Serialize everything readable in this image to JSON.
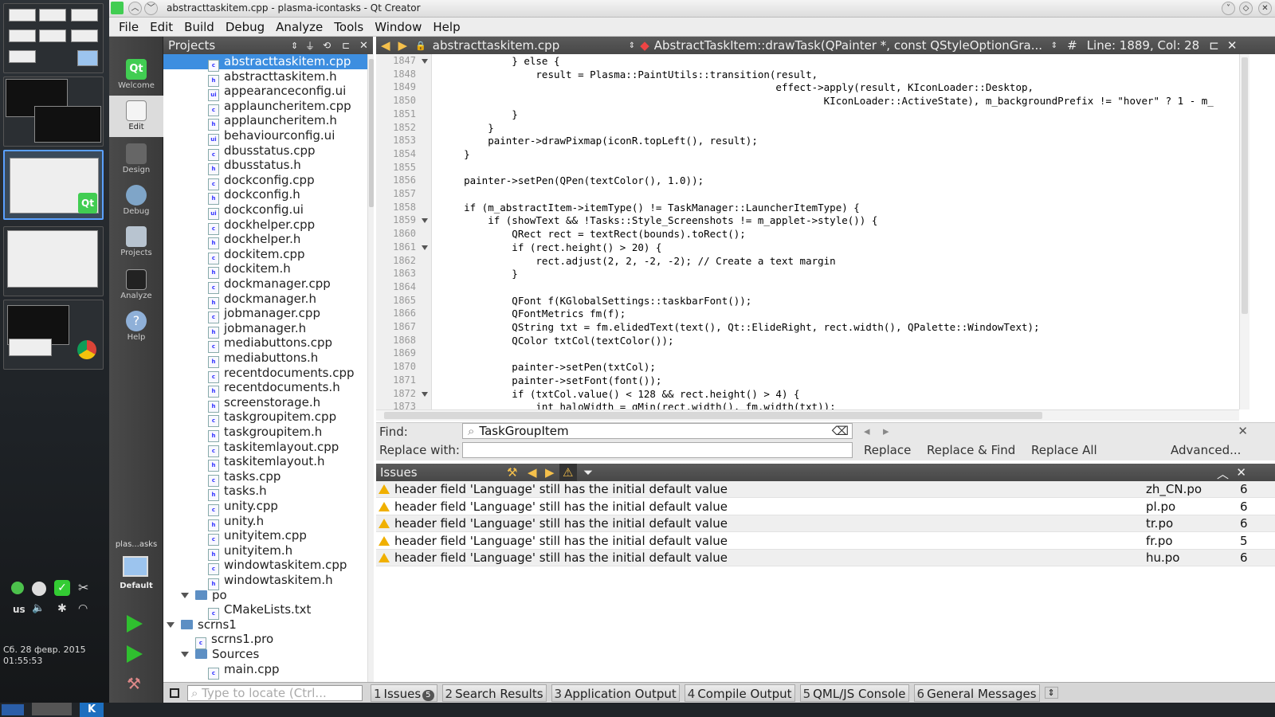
{
  "window": {
    "title": "abstracttaskitem.cpp - plasma-icontasks - Qt Creator"
  },
  "menu": [
    "File",
    "Edit",
    "Build",
    "Debug",
    "Analyze",
    "Tools",
    "Window",
    "Help"
  ],
  "modes": [
    {
      "label": "Welcome"
    },
    {
      "label": "Edit"
    },
    {
      "label": "Design"
    },
    {
      "label": "Debug"
    },
    {
      "label": "Projects"
    },
    {
      "label": "Analyze"
    },
    {
      "label": "Help"
    }
  ],
  "kit": {
    "project": "plas...asks",
    "config": "Default"
  },
  "projects": {
    "header": "Projects",
    "files": [
      "abstracttaskitem.cpp",
      "abstracttaskitem.h",
      "appearanceconfig.ui",
      "applauncheritem.cpp",
      "applauncheritem.h",
      "behaviourconfig.ui",
      "dbusstatus.cpp",
      "dbusstatus.h",
      "dockconfig.cpp",
      "dockconfig.h",
      "dockconfig.ui",
      "dockhelper.cpp",
      "dockhelper.h",
      "dockitem.cpp",
      "dockitem.h",
      "dockmanager.cpp",
      "dockmanager.h",
      "jobmanager.cpp",
      "jobmanager.h",
      "mediabuttons.cpp",
      "mediabuttons.h",
      "recentdocuments.cpp",
      "recentdocuments.h",
      "screenstorage.h",
      "taskgroupitem.cpp",
      "taskgroupitem.h",
      "taskitemlayout.cpp",
      "taskitemlayout.h",
      "tasks.cpp",
      "tasks.h",
      "unity.cpp",
      "unity.h",
      "unityitem.cpp",
      "unityitem.h",
      "windowtaskitem.cpp",
      "windowtaskitem.h"
    ],
    "po": "po",
    "po_file": "CMakeLists.txt",
    "project2": "scrns1",
    "project2_file": "scrns1.pro",
    "sources": "Sources",
    "main": "main.cpp"
  },
  "editor": {
    "file": "abstracttaskitem.cpp",
    "symbol": "AbstractTaskItem::drawTask(QPainter *, const QStyleOptionGra...",
    "position": "Line: 1889, Col: 28",
    "hash": "#",
    "lines": [
      {
        "n": "1847",
        "code": "            } else {"
      },
      {
        "n": "1848",
        "code": "                result = Plasma::PaintUtils::transition(result,"
      },
      {
        "n": "1849",
        "code": "                                                        effect->apply(result, KIconLoader::Desktop,"
      },
      {
        "n": "1850",
        "code": "                                                                KIconLoader::ActiveState), m_backgroundPrefix != \"hover\" ? 1 - m_"
      },
      {
        "n": "1851",
        "code": "            }"
      },
      {
        "n": "1852",
        "code": "        }"
      },
      {
        "n": "1853",
        "code": "        painter->drawPixmap(iconR.topLeft(), result);"
      },
      {
        "n": "1854",
        "code": "    }"
      },
      {
        "n": "1855",
        "code": ""
      },
      {
        "n": "1856",
        "code": "    painter->setPen(QPen(textColor(), 1.0));"
      },
      {
        "n": "1857",
        "code": ""
      },
      {
        "n": "1858",
        "code": "    if (m_abstractItem->itemType() != TaskManager::LauncherItemType) {"
      },
      {
        "n": "1859",
        "code": "        if (showText && !Tasks::Style_Screenshots != m_applet->style()) {"
      },
      {
        "n": "1860",
        "code": "            QRect rect = textRect(bounds).toRect();"
      },
      {
        "n": "1861",
        "code": "            if (rect.height() > 20) {"
      },
      {
        "n": "1862",
        "code": "                rect.adjust(2, 2, -2, -2); // Create a text margin"
      },
      {
        "n": "1863",
        "code": "            }"
      },
      {
        "n": "1864",
        "code": ""
      },
      {
        "n": "1865",
        "code": "            QFont f(KGlobalSettings::taskbarFont());"
      },
      {
        "n": "1866",
        "code": "            QFontMetrics fm(f);"
      },
      {
        "n": "1867",
        "code": "            QString txt = fm.elidedText(text(), Qt::ElideRight, rect.width(), QPalette::WindowText);"
      },
      {
        "n": "1868",
        "code": "            QColor txtCol(textColor());"
      },
      {
        "n": "1869",
        "code": ""
      },
      {
        "n": "1870",
        "code": "            painter->setPen(txtCol);"
      },
      {
        "n": "1871",
        "code": "            painter->setFont(font());"
      },
      {
        "n": "1872",
        "code": "            if (txtCol.value() < 128 && rect.height() > 4) {"
      },
      {
        "n": "1873",
        "code": "                int haloWidth = qMin(rect.width(), fm.width(txt));"
      }
    ]
  },
  "find": {
    "find_label": "Find:",
    "find_value": "TaskGroupItem",
    "replace_label": "Replace with:",
    "replace_value": "",
    "replace": "Replace",
    "replace_find": "Replace & Find",
    "replace_all": "Replace All",
    "advanced": "Advanced..."
  },
  "issues": {
    "title": "Issues",
    "rows": [
      {
        "msg": "header field 'Language' still has the initial default value",
        "file": "zh_CN.po",
        "line": "6"
      },
      {
        "msg": "header field 'Language' still has the initial default value",
        "file": "pl.po",
        "line": "6"
      },
      {
        "msg": "header field 'Language' still has the initial default value",
        "file": "tr.po",
        "line": "6"
      },
      {
        "msg": "header field 'Language' still has the initial default value",
        "file": "fr.po",
        "line": "5"
      },
      {
        "msg": "header field 'Language' still has the initial default value",
        "file": "hu.po",
        "line": "6"
      }
    ]
  },
  "statusbar": {
    "locate_placeholder": "Type to locate (Ctrl...",
    "tabs": [
      {
        "num": "1",
        "label": "Issues",
        "badge": "5"
      },
      {
        "num": "2",
        "label": "Search Results"
      },
      {
        "num": "3",
        "label": "Application Output"
      },
      {
        "num": "4",
        "label": "Compile Output"
      },
      {
        "num": "5",
        "label": "QML/JS Console"
      },
      {
        "num": "6",
        "label": "General Messages"
      }
    ]
  },
  "desktop": {
    "date": "Сб. 28 февр. 2015",
    "time": "01:55:53",
    "kbd": "us"
  }
}
